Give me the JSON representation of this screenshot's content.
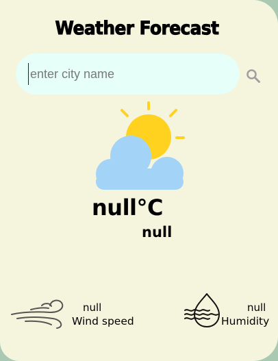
{
  "app": {
    "title": "Weather Forecast"
  },
  "search": {
    "placeholder": "enter city name",
    "value": "",
    "icon": "search-icon"
  },
  "current": {
    "icon": "partly-cloudy-icon",
    "temperature": "null°C",
    "description": "null"
  },
  "details": {
    "wind": {
      "icon": "wind-icon",
      "value": "null",
      "label": "Wind speed"
    },
    "humidity": {
      "icon": "humidity-icon",
      "value": "null",
      "label": "Humidity"
    }
  },
  "colors": {
    "card_background": "#f5f4dc",
    "page_background": "#a9c9b2",
    "search_background": "#e6fff9",
    "sun": "#ffd21f",
    "cloud": "#a3d4f7"
  }
}
